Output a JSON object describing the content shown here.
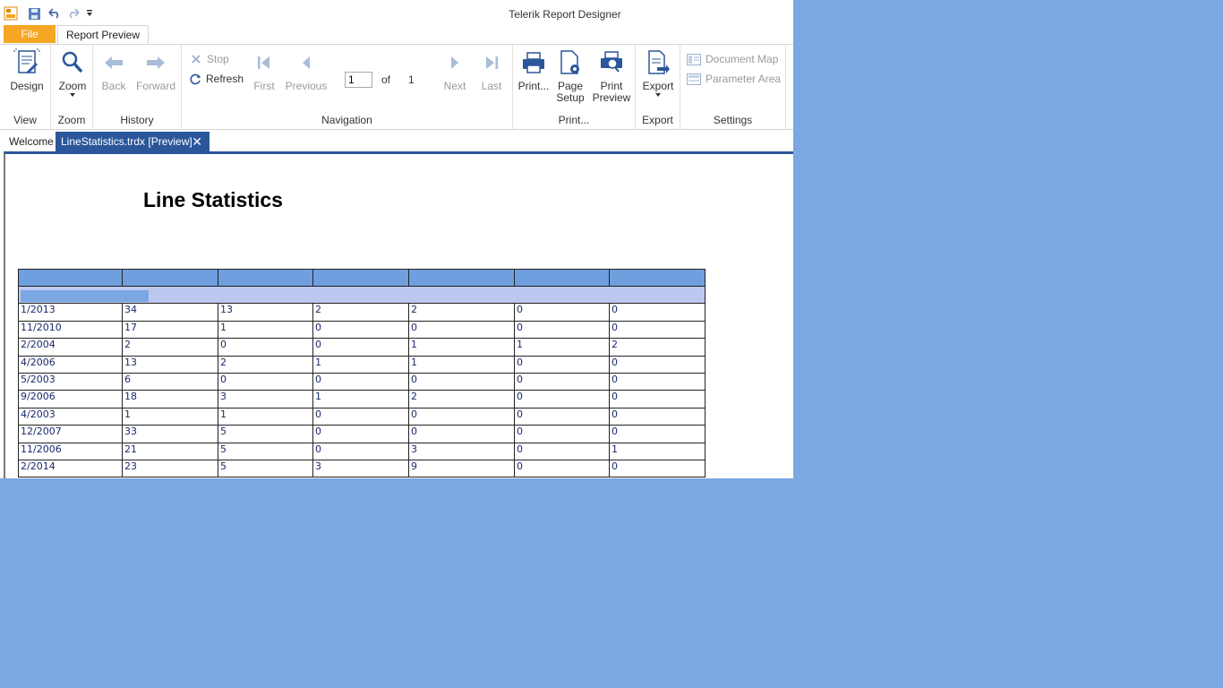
{
  "titlebar": {
    "title": "Telerik Report Designer",
    "quick_access": [
      "app-icon",
      "save-icon",
      "undo-icon",
      "redo-icon",
      "customize-icon"
    ]
  },
  "ribbon_tabs": {
    "file": "File",
    "report_preview": "Report Preview"
  },
  "ribbon": {
    "view": {
      "label": "View",
      "design": "Design"
    },
    "zoom": {
      "label": "Zoom",
      "zoom": "Zoom"
    },
    "history": {
      "label": "History",
      "back": "Back",
      "forward": "Forward"
    },
    "navigation": {
      "label": "Navigation",
      "stop": "Stop",
      "refresh": "Refresh",
      "first": "First",
      "previous": "Previous",
      "page": "1",
      "of": "of",
      "total": "1",
      "next": "Next",
      "last": "Last"
    },
    "print": {
      "label": "Print...",
      "print": "Print...",
      "page_setup_1": "Page",
      "page_setup_2": "Setup",
      "print_preview_1": "Print",
      "print_preview_2": "Preview"
    },
    "export": {
      "label": "Export",
      "export": "Export"
    },
    "settings": {
      "label": "Settings",
      "document_map": "Document Map",
      "parameter_area": "Parameter Area"
    }
  },
  "doc_tabs": {
    "welcome": "Welcome",
    "active": "LineStatistics.trdx [Preview]"
  },
  "report": {
    "title": "Line Statistics",
    "rows": [
      [
        "1/2013",
        "34",
        "13",
        "2",
        "2",
        "0",
        "0"
      ],
      [
        "11/2010",
        "17",
        "1",
        "0",
        "0",
        "0",
        "0"
      ],
      [
        "2/2004",
        "2",
        "0",
        "0",
        "1",
        "1",
        "2"
      ],
      [
        "4/2006",
        "13",
        "2",
        "1",
        "1",
        "0",
        "0"
      ],
      [
        "5/2003",
        "6",
        "0",
        "0",
        "0",
        "0",
        "0"
      ],
      [
        "9/2006",
        "18",
        "3",
        "1",
        "2",
        "0",
        "0"
      ],
      [
        "4/2003",
        "1",
        "1",
        "0",
        "0",
        "0",
        "0"
      ],
      [
        "12/2007",
        "33",
        "5",
        "0",
        "0",
        "0",
        "0"
      ],
      [
        "11/2006",
        "21",
        "5",
        "0",
        "3",
        "0",
        "1"
      ],
      [
        "2/2014",
        "23",
        "5",
        "3",
        "9",
        "0",
        "0"
      ]
    ]
  },
  "colors": {
    "accent": "#2b579a",
    "file_tab": "#f5a623",
    "header": "#6f9fde",
    "group_row": "#bcc8f0",
    "desktop": "#7ba7e2"
  }
}
